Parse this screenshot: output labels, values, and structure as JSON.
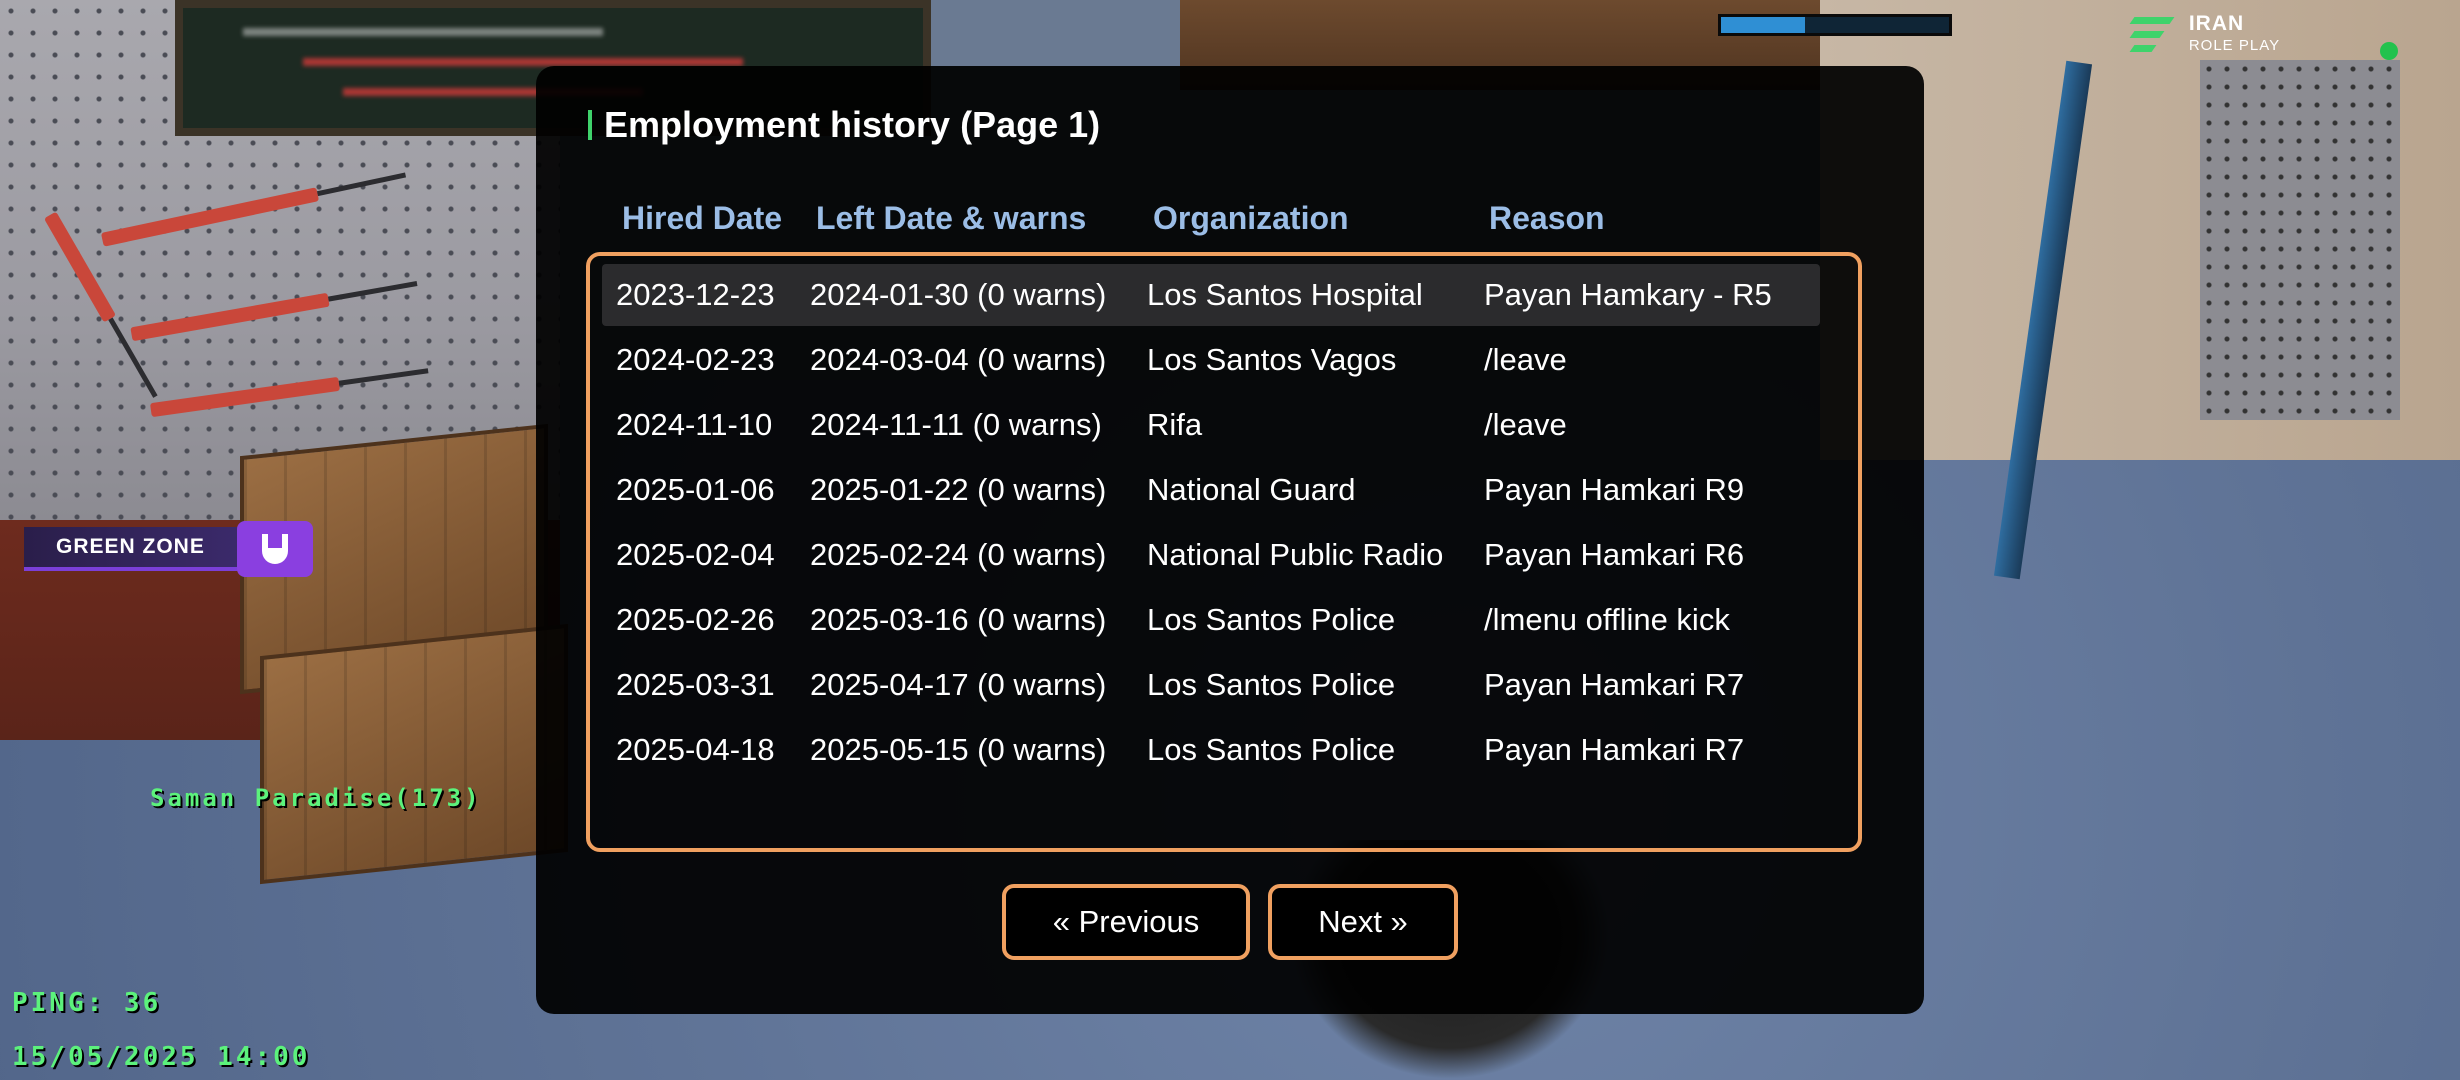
{
  "hud": {
    "health_fraction": 0.37,
    "brand": {
      "line1": "IRAN",
      "line2": "ROLE PLAY"
    },
    "zone_label": "GREEN ZONE",
    "player_tag": "Saman Paradise(173)",
    "ping": "PING: 36",
    "datetime": "15/05/2025 14:00",
    "colors": {
      "hud_green": "#5cf27c",
      "zone_purple": "#8a3fe0",
      "accent_orange": "#f0a060",
      "header_blue": "#9bbde6"
    }
  },
  "dialog": {
    "title": "Employment history (Page 1)",
    "columns": {
      "hired": "Hired Date",
      "left": "Left Date & warns",
      "org": "Organization",
      "reason": "Reason"
    },
    "rows": [
      {
        "hired": "2023-12-23",
        "left": "2024-01-30 (0 warns)",
        "org": "Los Santos Hospital",
        "reason": "Payan Hamkary - R5"
      },
      {
        "hired": "2024-02-23",
        "left": "2024-03-04 (0 warns)",
        "org": "Los Santos Vagos",
        "reason": "/leave"
      },
      {
        "hired": "2024-11-10",
        "left": "2024-11-11 (0 warns)",
        "org": "Rifa",
        "reason": "/leave"
      },
      {
        "hired": "2025-01-06",
        "left": "2025-01-22 (0 warns)",
        "org": "National Guard",
        "reason": "Payan Hamkari R9"
      },
      {
        "hired": "2025-02-04",
        "left": "2025-02-24 (0 warns)",
        "org": "National Public Radio",
        "reason": "Payan Hamkari R6"
      },
      {
        "hired": "2025-02-26",
        "left": "2025-03-16 (0 warns)",
        "org": "Los Santos Police",
        "reason": "/lmenu offline kick"
      },
      {
        "hired": "2025-03-31",
        "left": "2025-04-17 (0 warns)",
        "org": "Los Santos Police",
        "reason": "Payan Hamkari R7"
      },
      {
        "hired": "2025-04-18",
        "left": "2025-05-15 (0 warns)",
        "org": "Los Santos Police",
        "reason": "Payan Hamkari R7"
      }
    ],
    "selected_row": 0,
    "prev_label": "« Previous",
    "next_label": "Next »"
  }
}
